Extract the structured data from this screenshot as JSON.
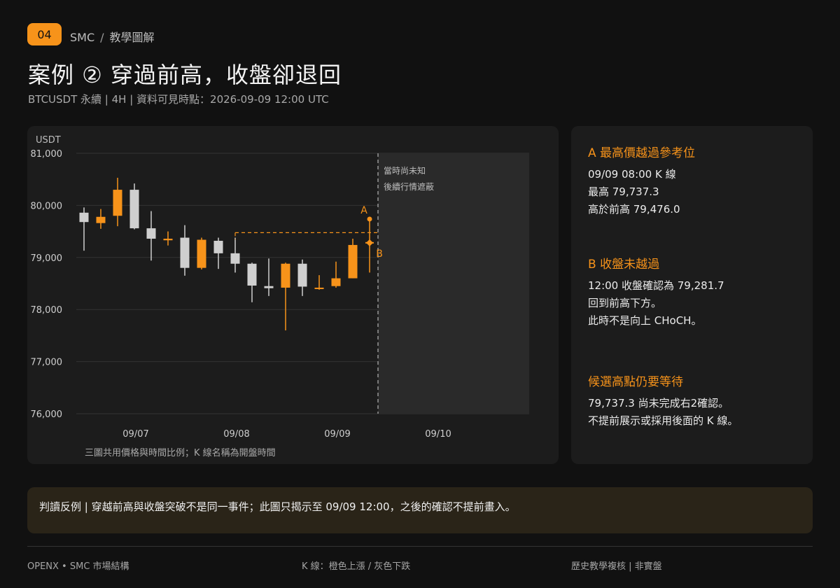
{
  "header": {
    "badge": "04",
    "crumb_left": "SMC",
    "crumb_sep": "/",
    "crumb_right": "教學圖解",
    "title": "案例 ② 穿過前高，收盤卻退回",
    "subtitle": "BTCUSDT 永續 | 4H | 資料可見時點：2026-09-09 12:00 UTC"
  },
  "chart_data": {
    "type": "candlestick",
    "ylabel": "USDT",
    "ylim": [
      76000,
      81000
    ],
    "y_ticks": [
      "81,000",
      "80,000",
      "79,000",
      "78,000",
      "77,000",
      "76,000"
    ],
    "y_tick_values": [
      81000,
      80000,
      79000,
      78000,
      77000,
      76000
    ],
    "x_ticks": [
      "09/07",
      "09/08",
      "09/09",
      "09/10"
    ],
    "caption": "三圖共用價格與時間比例；K 線名稱為開盤時間",
    "hidden_zone_label_1": "當時尚未知",
    "hidden_zone_label_2": "後續行情遮蔽",
    "marker_a": "A",
    "marker_b": "B",
    "prior_high": 79476.0,
    "colors": {
      "up": "#f7931a",
      "down": "#cfcfcf"
    },
    "candles": [
      {
        "open": 79860,
        "high": 79960,
        "low": 79130,
        "close": 79680
      },
      {
        "open": 79660,
        "high": 79930,
        "low": 79550,
        "close": 79780
      },
      {
        "open": 79800,
        "high": 80530,
        "low": 79600,
        "close": 80300
      },
      {
        "open": 80300,
        "high": 80420,
        "low": 79540,
        "close": 79560
      },
      {
        "open": 79560,
        "high": 79890,
        "low": 78940,
        "close": 79360
      },
      {
        "open": 79330,
        "high": 79500,
        "low": 79230,
        "close": 79360
      },
      {
        "open": 79380,
        "high": 79620,
        "low": 78650,
        "close": 78800
      },
      {
        "open": 78800,
        "high": 79380,
        "low": 78770,
        "close": 79340
      },
      {
        "open": 79320,
        "high": 79380,
        "low": 78780,
        "close": 79080
      },
      {
        "open": 79080,
        "high": 79380,
        "low": 78710,
        "close": 78880
      },
      {
        "open": 78880,
        "high": 78900,
        "low": 78140,
        "close": 78460
      },
      {
        "open": 78450,
        "high": 78980,
        "low": 78260,
        "close": 78410
      },
      {
        "open": 78420,
        "high": 78900,
        "low": 77600,
        "close": 78880
      },
      {
        "open": 78880,
        "high": 78960,
        "low": 78260,
        "close": 78440
      },
      {
        "open": 78400,
        "high": 78660,
        "low": 78380,
        "close": 78420
      },
      {
        "open": 78450,
        "high": 78920,
        "low": 78420,
        "close": 78600
      },
      {
        "open": 78600,
        "high": 79360,
        "low": 78600,
        "close": 79240
      },
      {
        "open": 79240,
        "high": 79737.3,
        "low": 78710,
        "close": 79281.7
      }
    ]
  },
  "section_a": {
    "title": "A  最高價越過參考位",
    "lines": [
      "09/09 08:00 K 線",
      "最高 79,737.3",
      "高於前高 79,476.0"
    ]
  },
  "section_b": {
    "title": "B  收盤未越過",
    "lines": [
      "12:00 收盤確認為 79,281.7",
      "回到前高下方。",
      "此時不是向上 CHoCH。"
    ]
  },
  "section_c": {
    "title": "候選高點仍要等待",
    "lines": [
      "79,737.3 尚未完成右2確認。",
      "不提前展示或採用後面的 K 線。"
    ]
  },
  "note": "判讀反例 | 穿越前高與收盤突破不是同一事件；此圖只揭示至 09/09 12:00，之後的確認不提前畫入。",
  "footer": {
    "left": "OPENX  •  SMC 市場結構",
    "center": "K 線：橙色上漲 / 灰色下跌",
    "right": "歷史教學複核 | 非實盤"
  }
}
